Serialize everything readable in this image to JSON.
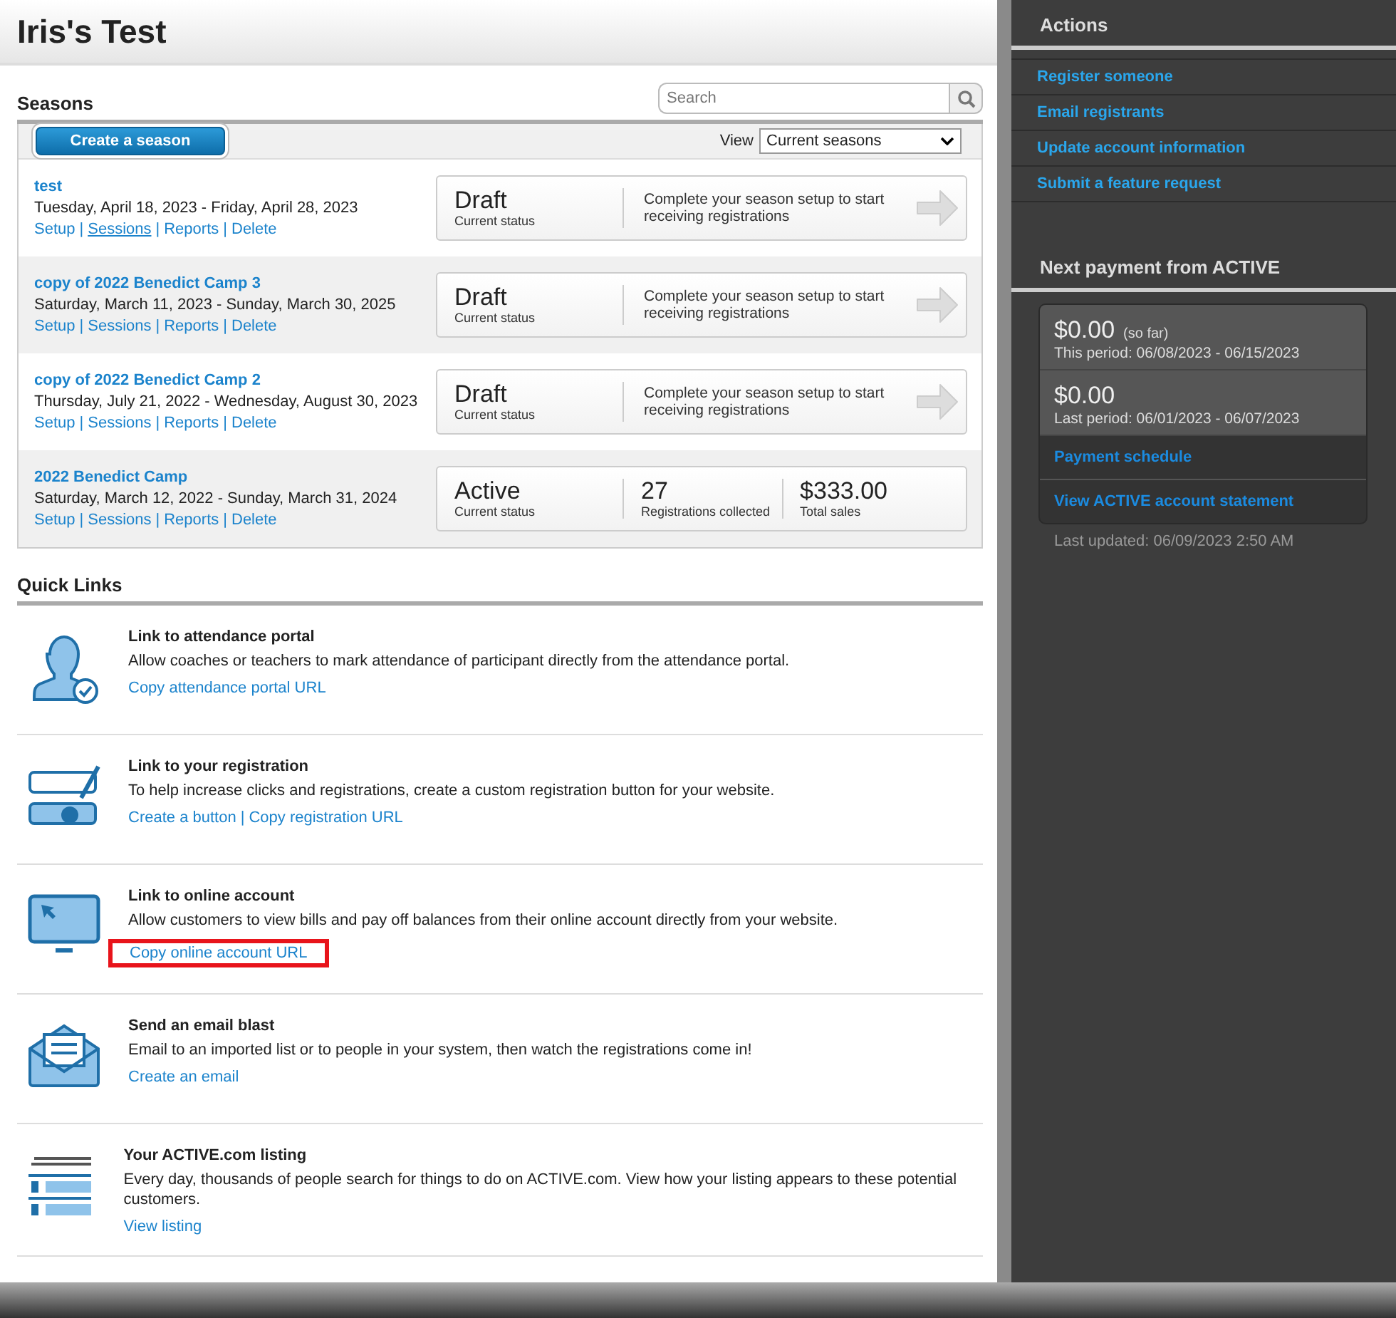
{
  "header": {
    "title": "Iris's Test"
  },
  "seasons": {
    "title": "Seasons",
    "separator": "|",
    "search": {
      "placeholder": "Search"
    },
    "create_button": "Create a season",
    "view": {
      "label": "View",
      "value": "Current seasons"
    },
    "rows": [
      {
        "name": "test",
        "dates": "Tuesday, April 18, 2023 - Friday, April 28, 2023",
        "links": [
          {
            "label": "Setup",
            "hovered": false
          },
          {
            "label": "Sessions",
            "hovered": true
          },
          {
            "label": "Reports",
            "hovered": false
          },
          {
            "label": "Delete",
            "hovered": false
          }
        ],
        "kind": "draft",
        "status": "Draft",
        "status_label": "Current status",
        "message": "Complete your season setup to start receiving registrations"
      },
      {
        "name": "copy of 2022 Benedict Camp 3",
        "dates": "Saturday, March 11, 2023 - Sunday, March 30, 2025",
        "links": [
          {
            "label": "Setup",
            "hovered": false
          },
          {
            "label": "Sessions",
            "hovered": false
          },
          {
            "label": "Reports",
            "hovered": false
          },
          {
            "label": "Delete",
            "hovered": false
          }
        ],
        "kind": "draft",
        "status": "Draft",
        "status_label": "Current status",
        "message": "Complete your season setup to start receiving registrations"
      },
      {
        "name": "copy of 2022 Benedict Camp 2",
        "dates": "Thursday, July 21, 2022 - Wednesday, August 30, 2023",
        "links": [
          {
            "label": "Setup",
            "hovered": false
          },
          {
            "label": "Sessions",
            "hovered": false
          },
          {
            "label": "Reports",
            "hovered": false
          },
          {
            "label": "Delete",
            "hovered": false
          }
        ],
        "kind": "draft",
        "status": "Draft",
        "status_label": "Current status",
        "message": "Complete your season setup to start receiving registrations"
      },
      {
        "name": "2022 Benedict Camp",
        "dates": "Saturday, March 12, 2022 - Sunday, March 31, 2024",
        "links": [
          {
            "label": "Setup",
            "hovered": false
          },
          {
            "label": "Sessions",
            "hovered": false
          },
          {
            "label": "Reports",
            "hovered": false
          },
          {
            "label": "Delete",
            "hovered": false
          }
        ],
        "kind": "active",
        "status": "Active",
        "status_label": "Current status",
        "stats": [
          {
            "value": "27",
            "label": "Registrations collected"
          },
          {
            "value": "$333.00",
            "label": "Total sales"
          }
        ]
      }
    ]
  },
  "quick_links": {
    "title": "Quick Links",
    "separator": "|",
    "items": [
      {
        "kind": "attendance",
        "title": "Link to attendance portal",
        "description": "Allow coaches or teachers to mark attendance of participant directly from the attendance portal.",
        "links": [
          {
            "label": "Copy attendance portal URL",
            "highlighted": false
          }
        ]
      },
      {
        "kind": "registration",
        "title": "Link to your registration",
        "description": "To help increase clicks and registrations, create a custom registration button for your website.",
        "links": [
          {
            "label": "Create a button",
            "highlighted": false
          },
          {
            "label": "Copy registration URL",
            "highlighted": false
          }
        ]
      },
      {
        "kind": "account",
        "title": "Link to online account",
        "description": "Allow customers to view bills and pay off balances from their online account directly from your website.",
        "links": [
          {
            "label": "Copy online account URL",
            "highlighted": true
          }
        ]
      },
      {
        "kind": "email",
        "title": "Send an email blast",
        "description": "Email to an imported list or to people in your system, then watch the registrations come in!",
        "links": [
          {
            "label": "Create an email",
            "highlighted": false
          }
        ]
      },
      {
        "kind": "listing",
        "title": "Your ACTIVE.com listing",
        "description": "Every day, thousands of people search for things to do on ACTIVE.com. View how your listing appears to these potential customers.",
        "links": [
          {
            "label": "View listing",
            "highlighted": false
          }
        ]
      }
    ]
  },
  "sidebar": {
    "actions_title": "Actions",
    "actions": [
      "Register someone",
      "Email registrants",
      "Update account information",
      "Submit a feature request"
    ],
    "payment_title": "Next payment from ACTIVE",
    "periods": [
      {
        "amount": "$0.00",
        "note": "(so far)",
        "period": "This period: 06/08/2023 - 06/15/2023"
      },
      {
        "amount": "$0.00",
        "period": "Last period: 06/01/2023 - 06/07/2023"
      }
    ],
    "links": [
      "Payment schedule",
      "View ACTIVE account statement"
    ],
    "last_updated": "Last updated: 06/09/2023 2:50 AM"
  }
}
